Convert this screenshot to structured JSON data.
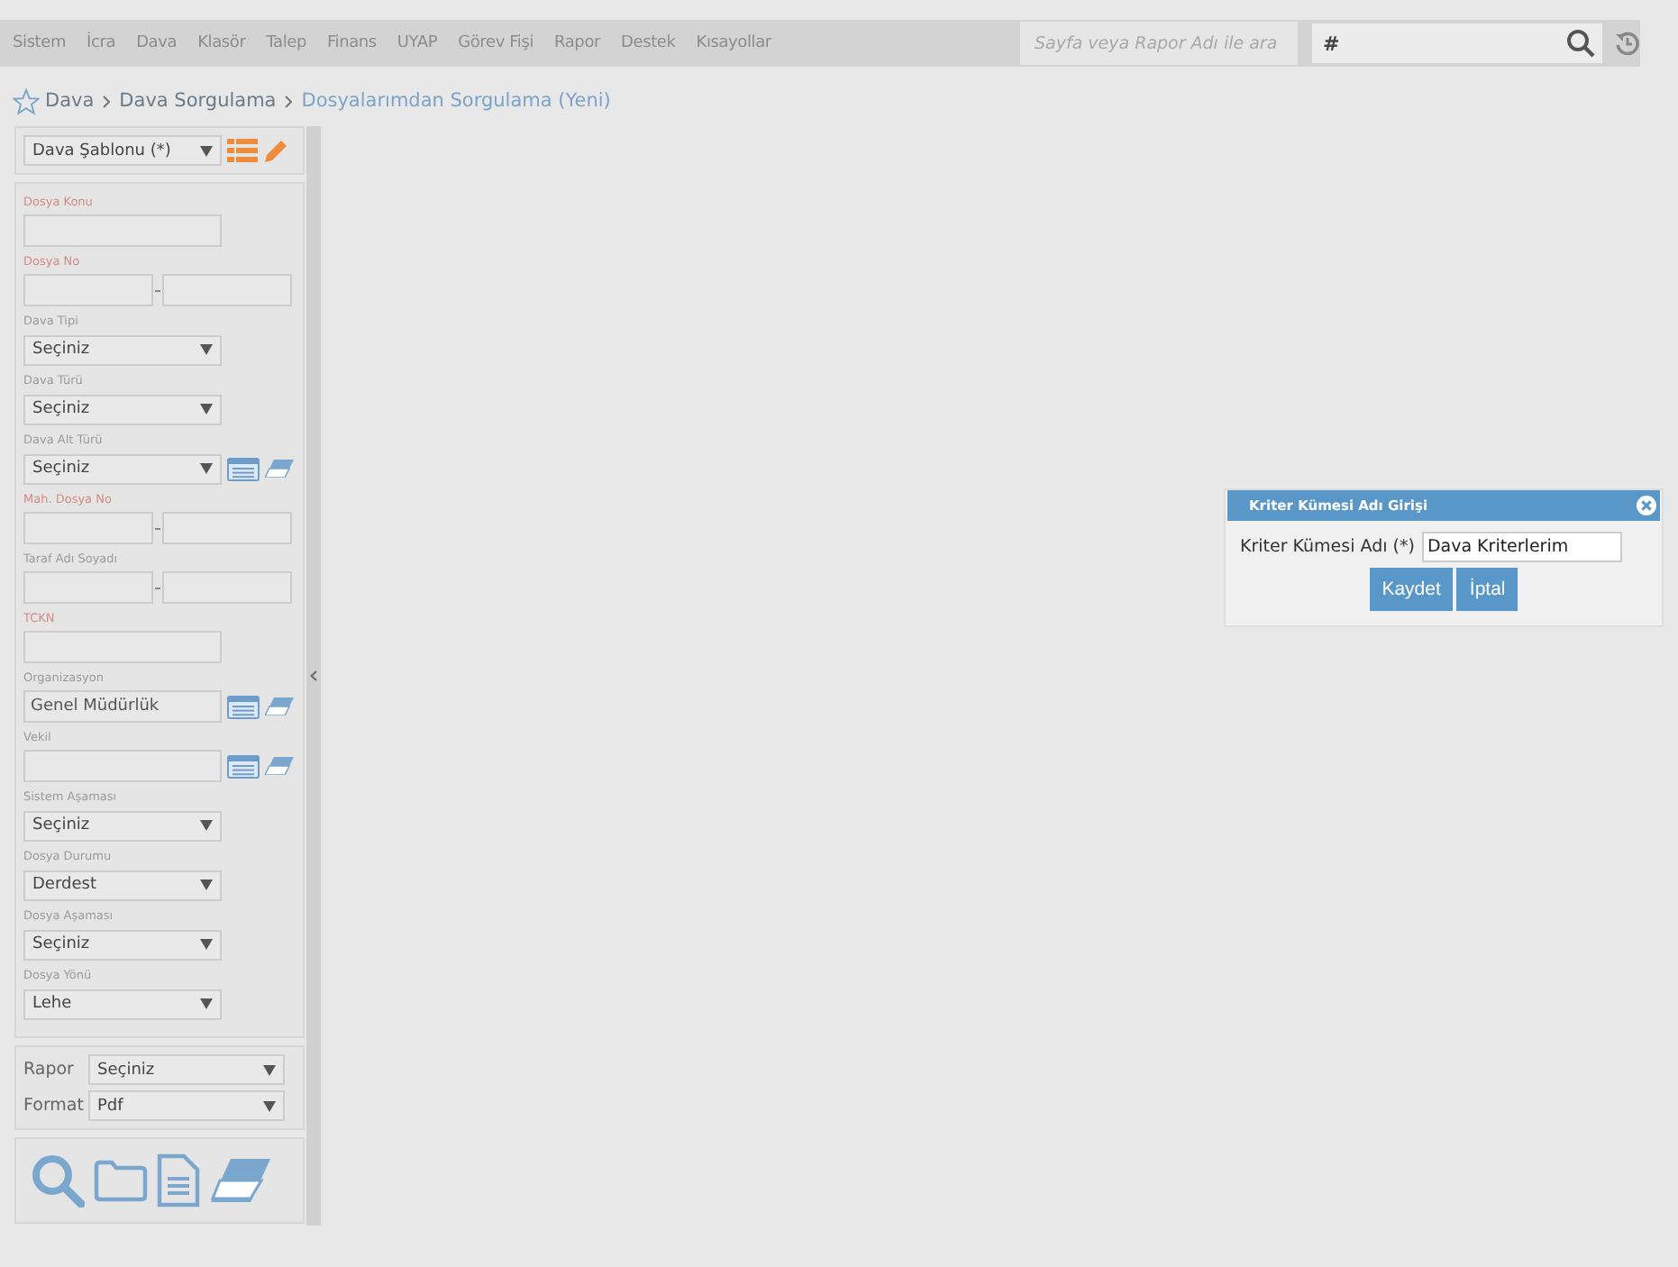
{
  "menu": [
    {
      "label": "Sistem"
    },
    {
      "label": "İcra"
    },
    {
      "label": "Dava"
    },
    {
      "label": "Klasör"
    },
    {
      "label": "Talep"
    },
    {
      "label": "Finans"
    },
    {
      "label": "UYAP"
    },
    {
      "label": "Görev Fişi"
    },
    {
      "label": "Rapor"
    },
    {
      "label": "Destek"
    },
    {
      "label": "Kısayollar"
    }
  ],
  "search": {
    "placeholder": "Sayfa veya Rapor Adı ile ara"
  },
  "quick_search": {
    "value": "#"
  },
  "breadcrumb": [
    {
      "label": "Dava",
      "current": false
    },
    {
      "label": "Dava Sorgulama",
      "current": false
    },
    {
      "label": "Dosyalarımdan Sorgulama (Yeni)",
      "current": true
    }
  ],
  "template": {
    "value": "Dava Şablonu (*)"
  },
  "fields": [
    {
      "label": "Dosya Konu",
      "required": true,
      "kind": "text"
    },
    {
      "label": "Dosya No",
      "required": true,
      "kind": "range"
    },
    {
      "label": "Dava Tipi",
      "required": false,
      "kind": "select",
      "value": "Seçiniz"
    },
    {
      "label": "Dava Türü",
      "required": false,
      "kind": "select",
      "value": "Seçiniz"
    },
    {
      "label": "Dava Alt Türü",
      "required": false,
      "kind": "select_tools",
      "value": "Seçiniz"
    },
    {
      "label": "Mah. Dosya No",
      "required": true,
      "kind": "range"
    },
    {
      "label": "Taraf Adı Soyadı",
      "required": false,
      "kind": "range"
    },
    {
      "label": "TCKN",
      "required": true,
      "kind": "text"
    },
    {
      "label": "Organizasyon",
      "required": false,
      "kind": "text_tools",
      "value": "Genel Müdürlük"
    },
    {
      "label": "Vekil",
      "required": false,
      "kind": "text_tools"
    },
    {
      "label": "Sistem Aşaması",
      "required": false,
      "kind": "select",
      "value": "Seçiniz"
    },
    {
      "label": "Dosya Durumu",
      "required": false,
      "kind": "select",
      "value": "Derdest"
    },
    {
      "label": "Dosya Aşaması",
      "required": false,
      "kind": "select",
      "value": "Seçiniz"
    },
    {
      "label": "Dosya Yönü",
      "required": false,
      "kind": "select",
      "value": "Lehe"
    }
  ],
  "report": [
    {
      "label": "Rapor",
      "value": "Seçiniz"
    },
    {
      "label": "Format",
      "value": "Pdf"
    }
  ],
  "dialog": {
    "title": "Kriter Kümesi Adı Girişi",
    "label": "Kriter Kümesi Adı (*)",
    "value": "Dava Kriterlerim",
    "buttons": [
      "Kaydet",
      "İptal"
    ]
  }
}
